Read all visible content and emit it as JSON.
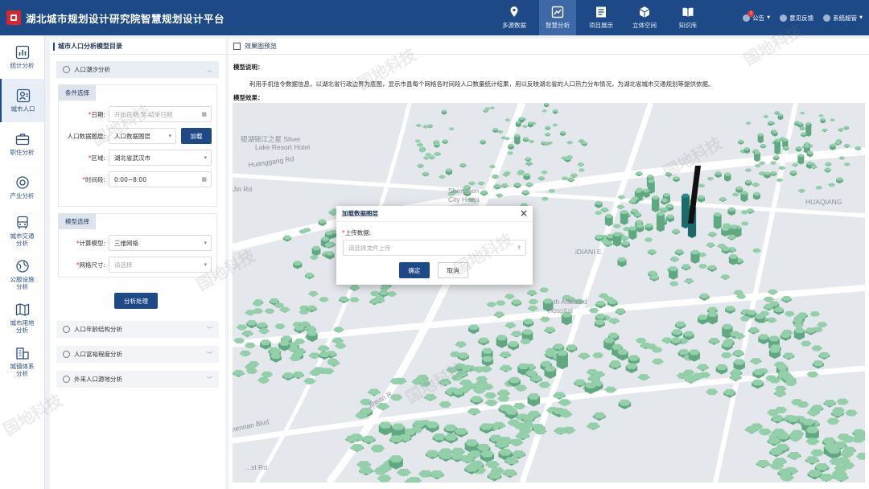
{
  "header": {
    "title": "湖北城市规划设计研究院智慧规划设计平台",
    "nav": [
      {
        "label": "多源数据",
        "icon": "map-pin-icon"
      },
      {
        "label": "智慧分析",
        "icon": "chart-icon"
      },
      {
        "label": "项目展示",
        "icon": "document-icon"
      },
      {
        "label": "立体空间",
        "icon": "cube-icon"
      },
      {
        "label": "知识库",
        "icon": "book-icon"
      }
    ],
    "right": {
      "notice": "公告",
      "notice_badge": "2",
      "feedback": "意见反馈",
      "user": "系统超管"
    }
  },
  "sidebar": {
    "items": [
      {
        "label": "统计分析",
        "icon": "bar-chart-icon"
      },
      {
        "label": "城市人口",
        "icon": "population-icon"
      },
      {
        "label": "职住分析",
        "icon": "briefcase-icon"
      },
      {
        "label": "产业分析",
        "icon": "industry-icon"
      },
      {
        "label": "城市交通\n分析",
        "icon": "bus-icon"
      },
      {
        "label": "公服设施\n分析",
        "icon": "globe-icon"
      },
      {
        "label": "城市用地\n分析",
        "icon": "land-map-icon"
      },
      {
        "label": "城镇体系\n分析",
        "icon": "buildings-icon"
      }
    ]
  },
  "catalog": {
    "title": "城市人口分析模型目录",
    "active_model": "人口潮汐分析",
    "conditions_tag": "条件选择",
    "date_label": "日期",
    "date_placeholder": "开始日期 至 结束日期",
    "layer_label": "人口数据图层:",
    "layer_value": "人口数据图层",
    "load_button": "加载",
    "region_label": "区域",
    "region_value": "湖北省武汉市",
    "time_label": "时间段",
    "time_value": "0:00~8:00",
    "model_tag": "模型选择",
    "calc_label": "计算模型",
    "calc_value": "三维网格",
    "grid_label": "网格尺寸",
    "grid_placeholder": "请选择",
    "process_button": "分析处理",
    "other_models": [
      "人口年龄结构分析",
      "人口富裕程度分析",
      "外来人口源地分析"
    ]
  },
  "main": {
    "title": "效果图预览",
    "desc_label": "模型说明：",
    "desc_text": "利用手机信令数据信息，以湖北省行政边界为底图，显示市县每个网格各时间段人口数量统计结果，用以反映湖北省的人口热力分布情况，为湖北省城市交通规划等提供依据。",
    "effect_label": "模型效果："
  },
  "map_labels": [
    "银湖锦江之星 Silver",
    "Lake Resort Hotel",
    "Huanggang Rd",
    "Shenzhen",
    "City Hospi",
    "Jintian R",
    "Shennan Blvd",
    "...th Affiliated",
    "Hospital",
    "HUAQIANG",
    "Jin Rd",
    "iDIANI E",
    "...st Rd"
  ],
  "modal": {
    "title": "加载数据图层",
    "upload_label": "上传数据:",
    "upload_placeholder": "请选择文件上传",
    "confirm": "确定",
    "cancel": "取消"
  },
  "watermark": "国地科技",
  "colors": {
    "header": "#1d4a86",
    "accent": "#1d4a86",
    "hex_light": "#8fc9a5",
    "hex_dark": "#1e6b6a",
    "required": "#e33333"
  }
}
